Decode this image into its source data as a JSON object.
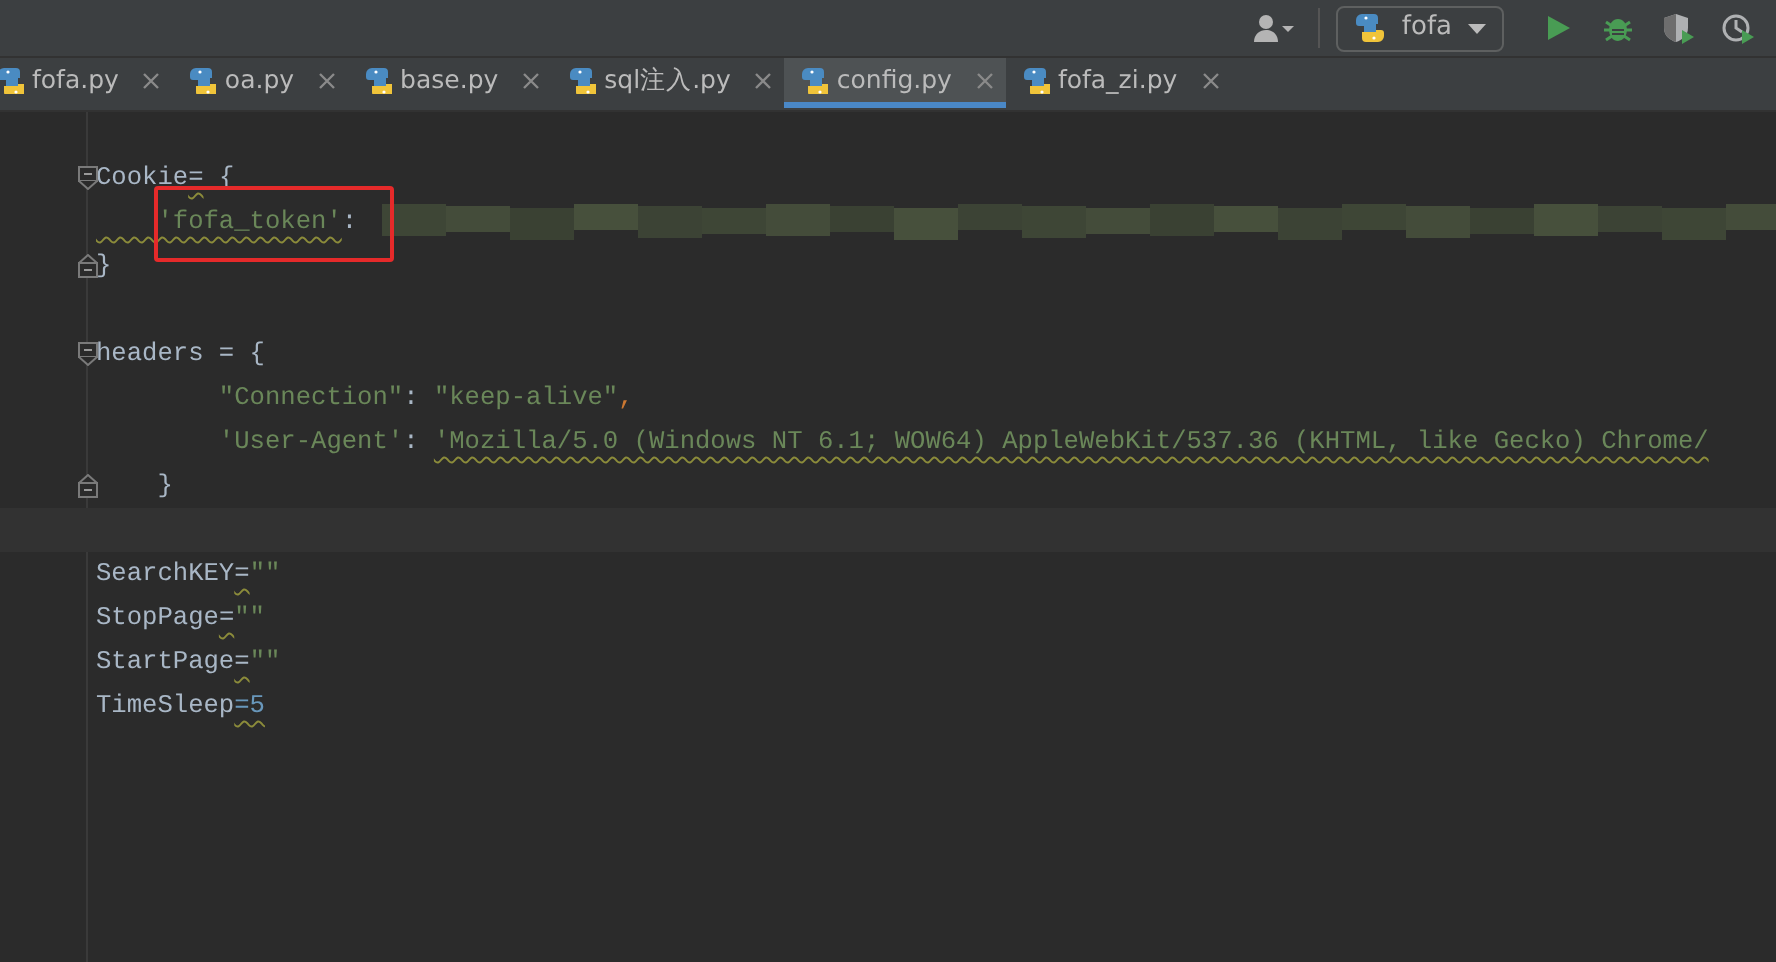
{
  "toolbar": {
    "run_config": "fofa"
  },
  "tabs": [
    {
      "label": "fofa.py",
      "selected": false
    },
    {
      "label": "oa.py",
      "selected": false
    },
    {
      "label": "base.py",
      "selected": false
    },
    {
      "label": "sql注入.py",
      "selected": false
    },
    {
      "label": "config.py",
      "selected": true
    },
    {
      "label": "fofa_zi.py",
      "selected": false
    }
  ],
  "editor": {
    "lines": [
      {
        "kind": "blank"
      },
      {
        "kind": "code",
        "fold_start": true,
        "tokens": [
          {
            "text": "Cookie",
            "kind": "name"
          },
          {
            "text": "=",
            "kind": "op",
            "warning": true
          },
          {
            "text": " {",
            "kind": "op"
          }
        ]
      },
      {
        "kind": "code",
        "redacted": true,
        "highlighted": true,
        "tokens": [
          {
            "text": "    'fofa_token'",
            "kind": "string",
            "warning": true
          },
          {
            "text": ":",
            "kind": "op"
          }
        ]
      },
      {
        "kind": "code",
        "fold_end": true,
        "tokens": [
          {
            "text": "}",
            "kind": "op"
          }
        ]
      },
      {
        "kind": "blank"
      },
      {
        "kind": "code",
        "fold_start": true,
        "tokens": [
          {
            "text": "headers = {",
            "kind": "name"
          }
        ]
      },
      {
        "kind": "code",
        "tokens": [
          {
            "text": "        \"Connection\"",
            "kind": "string"
          },
          {
            "text": ": ",
            "kind": "op"
          },
          {
            "text": "\"keep-alive\"",
            "kind": "string"
          },
          {
            "text": ",",
            "kind": "punct"
          }
        ]
      },
      {
        "kind": "code",
        "tokens": [
          {
            "text": "        'User-Agent'",
            "kind": "string"
          },
          {
            "text": ": ",
            "kind": "op"
          },
          {
            "text": "'Mozilla/5.0 (Windows NT 6.1; WOW64) AppleWebKit/537.36 (KHTML, like Gecko) Chrome/",
            "kind": "string",
            "warning": true
          }
        ]
      },
      {
        "kind": "code",
        "fold_end": true,
        "tokens": [
          {
            "text": "    }",
            "kind": "op"
          }
        ]
      },
      {
        "kind": "blank",
        "current": true
      },
      {
        "kind": "code",
        "tokens": [
          {
            "text": "SearchKEY",
            "kind": "name"
          },
          {
            "text": "=",
            "kind": "op",
            "warning": true
          },
          {
            "text": "\"\"",
            "kind": "string"
          }
        ]
      },
      {
        "kind": "code",
        "tokens": [
          {
            "text": "StopPage",
            "kind": "name"
          },
          {
            "text": "=",
            "kind": "op",
            "warning": true
          },
          {
            "text": "\"\"",
            "kind": "string"
          }
        ]
      },
      {
        "kind": "code",
        "tokens": [
          {
            "text": "StartPage",
            "kind": "name"
          },
          {
            "text": "=",
            "kind": "op",
            "warning": true
          },
          {
            "text": "\"\"",
            "kind": "string"
          }
        ]
      },
      {
        "kind": "code",
        "tokens": [
          {
            "text": "TimeSleep",
            "kind": "name"
          },
          {
            "text": "=5",
            "kind": "number",
            "warning": true
          }
        ]
      }
    ]
  }
}
